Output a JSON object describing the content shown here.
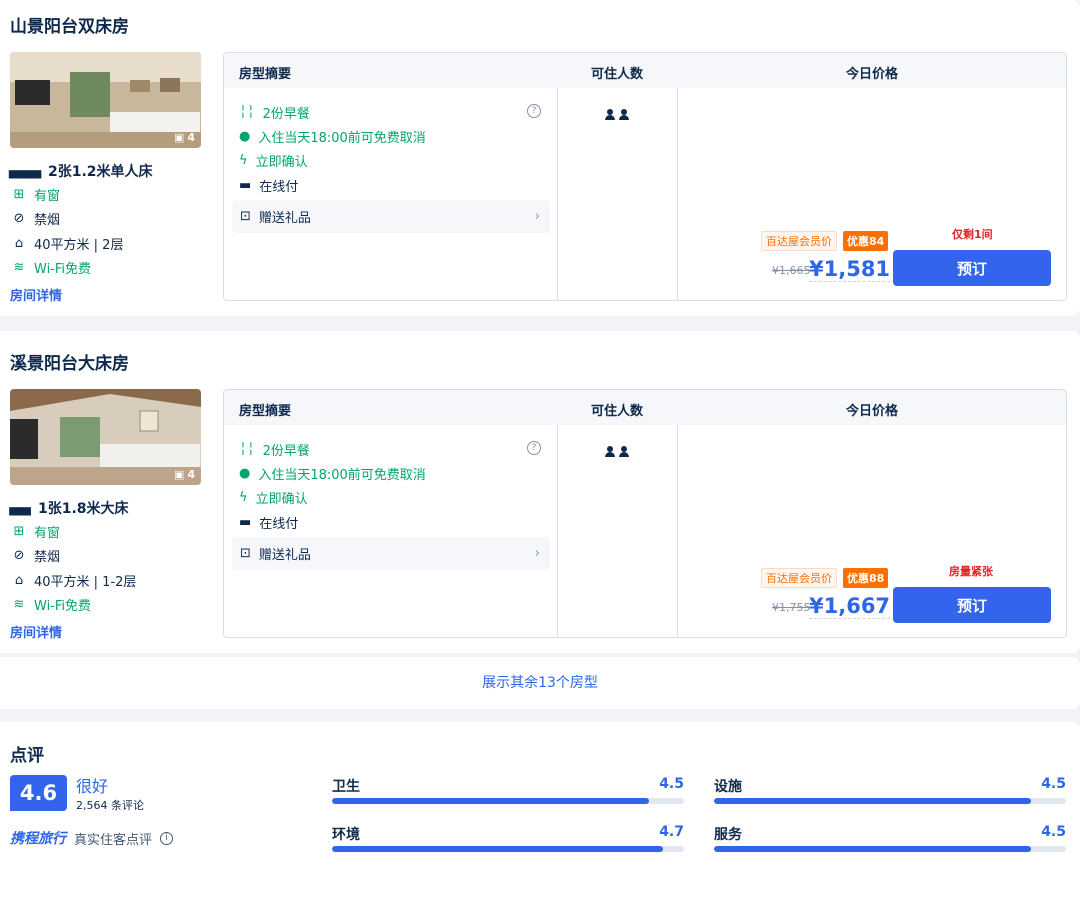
{
  "rooms": [
    {
      "name": "山景阳台双床房",
      "photo_count": "4",
      "bed": "2张1.2米单人床",
      "window": "有窗",
      "smoking": "禁烟",
      "area": "40平方米 | 2层",
      "wifi": "Wi-Fi免费",
      "details_link": "房间详情",
      "header": {
        "summary": "房型摘要",
        "guests": "可住人数",
        "price": "今日价格"
      },
      "breakfast": "2份早餐",
      "cancel": "入住当天18:00前可免费取消",
      "confirm": "立即确认",
      "payment": "在线付",
      "gift": "赠送礼品",
      "guest_count": 2,
      "member_label": "百达屋会员价",
      "member_discount": "优惠84",
      "original_price": "¥1,665",
      "price": "¥1,581",
      "scarcity": "仅剩1间",
      "book": "预订"
    },
    {
      "name": "溪景阳台大床房",
      "photo_count": "4",
      "bed": "1张1.8米大床",
      "window": "有窗",
      "smoking": "禁烟",
      "area": "40平方米 | 1-2层",
      "wifi": "Wi-Fi免费",
      "details_link": "房间详情",
      "header": {
        "summary": "房型摘要",
        "guests": "可住人数",
        "price": "今日价格"
      },
      "breakfast": "2份早餐",
      "cancel": "入住当天18:00前可免费取消",
      "confirm": "立即确认",
      "payment": "在线付",
      "gift": "赠送礼品",
      "guest_count": 2,
      "member_label": "百达屋会员价",
      "member_discount": "优惠88",
      "original_price": "¥1,755",
      "price": "¥1,667",
      "scarcity": "房量紧张",
      "book": "预订"
    }
  ],
  "more_rooms": "展示其余13个房型",
  "reviews": {
    "title": "点评",
    "score": "4.6",
    "rating_word": "很好",
    "count": "2,564 条评论",
    "source_logo": "携程旅行",
    "source_text": "真实住客点评",
    "subscores": [
      {
        "name": "卫生",
        "value": "4.5",
        "fraction": 0.9
      },
      {
        "name": "设施",
        "value": "4.5",
        "fraction": 0.9
      },
      {
        "name": "环境",
        "value": "4.7",
        "fraction": 0.94
      },
      {
        "name": "服务",
        "value": "4.5",
        "fraction": 0.9
      }
    ]
  },
  "colors": {
    "accent": "#2e66e8",
    "book_button": "#3264ed",
    "member": "#ff6f00",
    "scarce": "#e02424",
    "green": "#00a56b"
  }
}
